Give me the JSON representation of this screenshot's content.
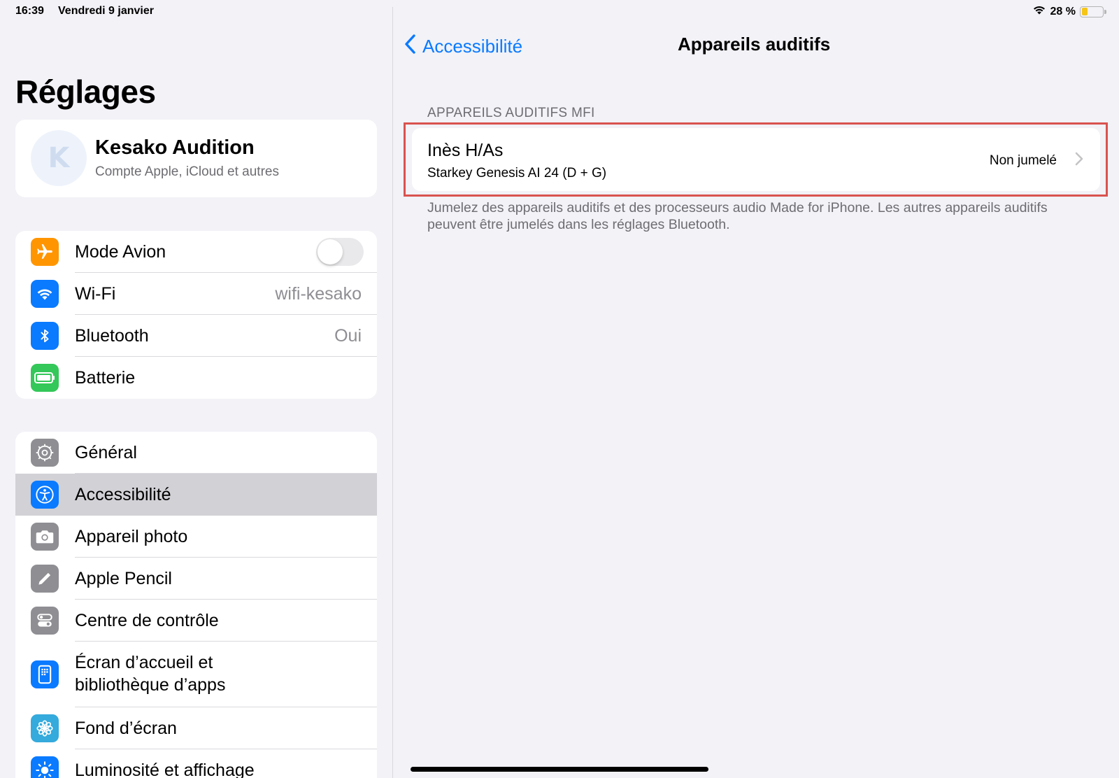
{
  "status_bar": {
    "time": "16:39",
    "date": "Vendredi 9 janvier",
    "battery_text": "28 %",
    "battery_level": 0.28
  },
  "sidebar": {
    "title": "Réglages",
    "profile": {
      "initial": "K",
      "name": "Kesako Audition",
      "subtitle": "Compte Apple, iCloud et autres"
    },
    "group1": [
      {
        "label": "Mode Avion",
        "icon": "airplane-icon",
        "color": "#ff9500",
        "toggle": false
      },
      {
        "label": "Wi-Fi",
        "icon": "wifi-icon",
        "color": "#0a7aff",
        "value": "wifi-kesako"
      },
      {
        "label": "Bluetooth",
        "icon": "bluetooth-icon",
        "color": "#0a7aff",
        "value": "Oui"
      },
      {
        "label": "Batterie",
        "icon": "battery-icon",
        "color": "#34c759"
      }
    ],
    "group2": [
      {
        "label": "Général",
        "icon": "gear-icon",
        "color": "#8e8e93"
      },
      {
        "label": "Accessibilité",
        "icon": "accessibility-icon",
        "color": "#0a7aff",
        "selected": true
      },
      {
        "label": "Appareil photo",
        "icon": "camera-icon",
        "color": "#8e8e93"
      },
      {
        "label": "Apple Pencil",
        "icon": "pencil-icon",
        "color": "#8e8e93"
      },
      {
        "label": "Centre de contrôle",
        "icon": "control-center-icon",
        "color": "#8e8e93"
      },
      {
        "label": "Écran d’accueil et",
        "label2": "bibliothèque d’apps",
        "icon": "home-screen-icon",
        "color": "#0a7aff"
      },
      {
        "label": "Fond d’écran",
        "icon": "flower-icon",
        "color": "#35aadc"
      },
      {
        "label": "Luminosité et affichage",
        "icon": "sun-icon",
        "color": "#0a7aff"
      }
    ]
  },
  "main": {
    "back_label": "Accessibilité",
    "title": "Appareils auditifs",
    "section_header": "APPAREILS AUDITIFS MFI",
    "device": {
      "name": "Inès H/As",
      "model": "Starkey Genesis AI 24 (D + G)",
      "status": "Non jumelé"
    },
    "footer_note": "Jumelez des appareils auditifs et des processeurs audio Made for iPhone. Les autres appareils auditifs peuvent être jumelés dans les réglages Bluetooth."
  },
  "colors": {
    "accent": "#0a7aff",
    "highlight": "#d9534f",
    "background": "#f2f2f7"
  }
}
